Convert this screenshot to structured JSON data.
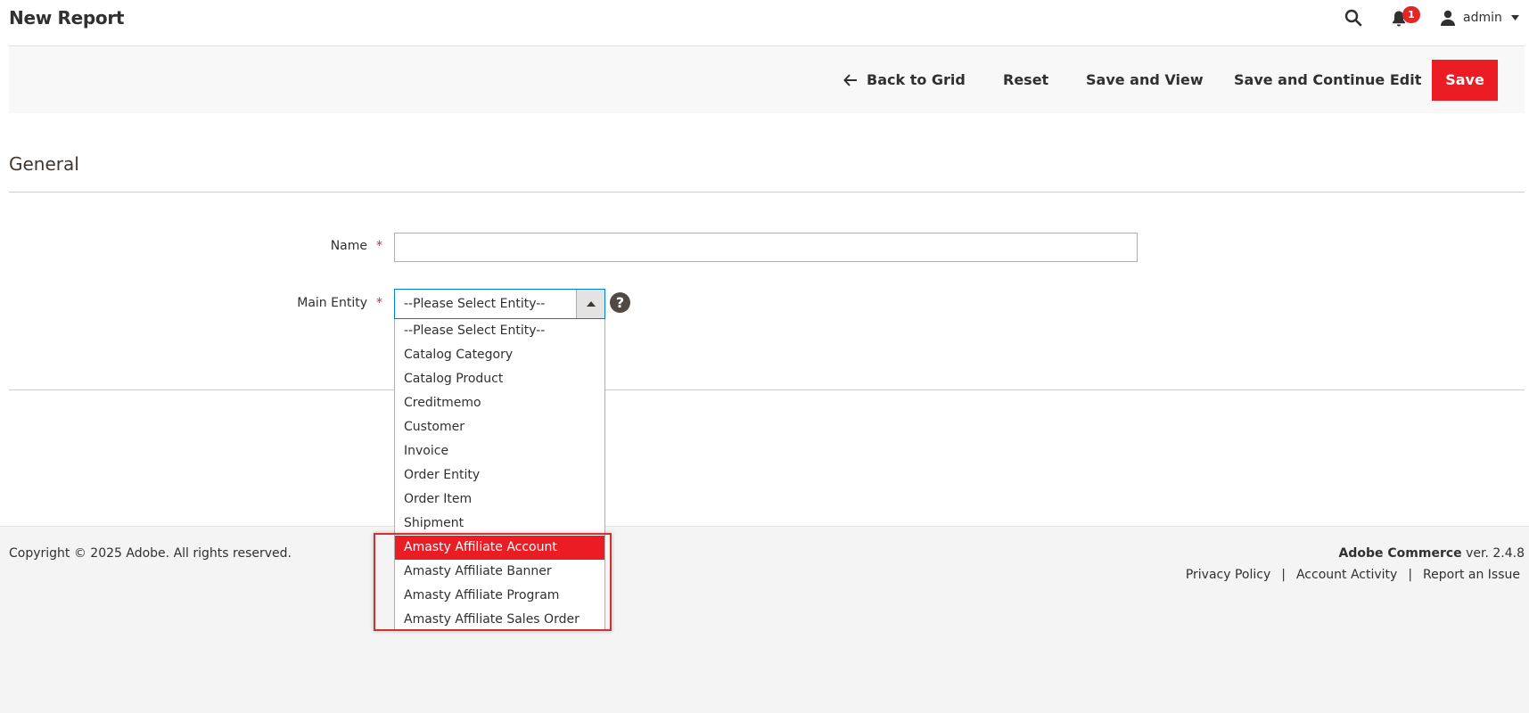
{
  "header": {
    "title": "New Report",
    "notification_count": "1",
    "user_name": "admin",
    "icons": [
      "search-icon",
      "bell-icon",
      "user-icon",
      "caret-down-icon"
    ]
  },
  "actions": {
    "back": "Back to Grid",
    "reset": "Reset",
    "save_and_view": "Save and View",
    "save_and_continue": "Save and Continue Edit",
    "save": "Save"
  },
  "section": {
    "title": "General"
  },
  "form": {
    "name_label": "Name",
    "name_value": "",
    "entity_label": "Main Entity",
    "entity_value": "--Please Select Entity--",
    "required_mark": "*",
    "help_mark": "?"
  },
  "dropdown": {
    "options": [
      "--Please Select Entity--",
      "Catalog Category",
      "Catalog Product",
      "Creditmemo",
      "Customer",
      "Invoice",
      "Order Entity",
      "Order Item",
      "Shipment",
      "Amasty Affiliate Account",
      "Amasty Affiliate Banner",
      "Amasty Affiliate Program",
      "Amasty Affiliate Sales Order"
    ],
    "highlighted_option": "Amasty Affiliate Account"
  },
  "footer": {
    "copyright": "Copyright © 2025 Adobe. All rights reserved.",
    "product": "Adobe Commerce",
    "version": " ver. 2.4.8",
    "links": [
      "Privacy Policy",
      "Account Activity",
      "Report an Issue"
    ],
    "separator": "|"
  },
  "colors": {
    "accent": "#eb1c24",
    "focus_border": "#007bdb",
    "highlight_border": "#d33131"
  }
}
